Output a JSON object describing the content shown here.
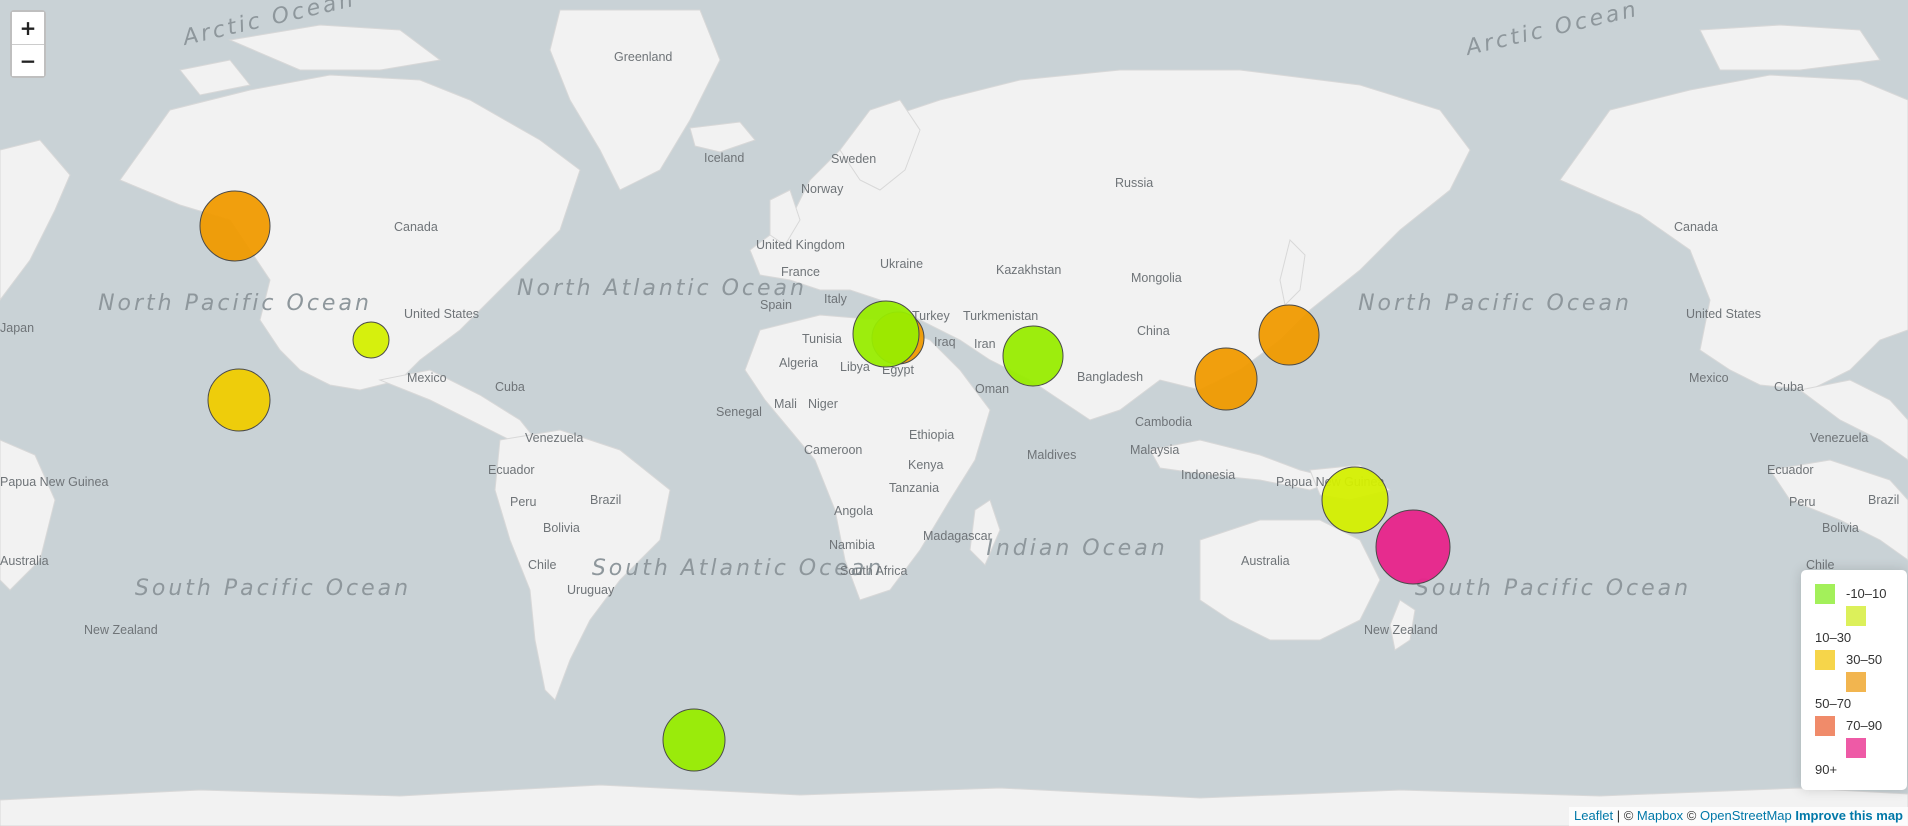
{
  "zoom": {
    "in_label": "+",
    "out_label": "−"
  },
  "oceans": [
    "Arctic Ocean",
    "Arctic Ocean",
    "North Pacific Ocean",
    "North Pacific Ocean",
    "North Atlantic Ocean",
    "South Pacific Ocean",
    "South Pacific Ocean",
    "South Atlantic Ocean",
    "Indian Ocean"
  ],
  "places": [
    "Greenland",
    "Iceland",
    "Sweden",
    "Norway",
    "Russia",
    "Canada",
    "Canada",
    "United Kingdom",
    "France",
    "Ukraine",
    "Kazakhstan",
    "Mongolia",
    "Spain",
    "Italy",
    "Turkey",
    "Turkmenistan",
    "United States",
    "United States",
    "Tunisia",
    "Iraq",
    "Iran",
    "China",
    "Algeria",
    "Libya",
    "Egypt",
    "Mexico",
    "Mexico",
    "Cuba",
    "Cuba",
    "Oman",
    "Bangladesh",
    "Senegal",
    "Mali",
    "Niger",
    "Venezuela",
    "Venezuela",
    "Ethiopia",
    "Cambodia",
    "Ecuador",
    "Ecuador",
    "Cameroon",
    "Maldives",
    "Malaysia",
    "Papua New Guinea",
    "Papua New Guinea",
    "Kenya",
    "Indonesia",
    "Peru",
    "Peru",
    "Brazil",
    "Brazil",
    "Tanzania",
    "Bolivia",
    "Bolivia",
    "Angola",
    "Madagascar",
    "Namibia",
    "Chile",
    "Chile",
    "South Africa",
    "Australia",
    "Australia",
    "Uruguay",
    "New Zealand",
    "New Zealand",
    "Japan"
  ],
  "earthquakes": [
    {
      "place": "Alaska",
      "depth_band": "50–70",
      "color": "#f09a00"
    },
    {
      "place": "Hawaii",
      "depth_band": "30–50",
      "color": "#f0cc00"
    },
    {
      "place": "California",
      "depth_band": "10–30",
      "color": "#d4ef00"
    },
    {
      "place": "Eastern Mediterranean",
      "depth_band": "50–70",
      "color": "#f09a00"
    },
    {
      "place": "Eastern Mediterranean",
      "depth_band": "-10–10",
      "color": "#98ec00"
    },
    {
      "place": "Pakistan",
      "depth_band": "-10–10",
      "color": "#98ec00"
    },
    {
      "place": "Philippines",
      "depth_band": "50–70",
      "color": "#f09a00"
    },
    {
      "place": "Japan",
      "depth_band": "50–70",
      "color": "#f09a00"
    },
    {
      "place": "Papua New Guinea",
      "depth_band": "10–30",
      "color": "#d4ef00"
    },
    {
      "place": "Vanuatu",
      "depth_band": "90+",
      "color": "#e8238a"
    },
    {
      "place": "South Atlantic",
      "depth_band": "-10–10",
      "color": "#98ec00"
    }
  ],
  "legend": {
    "items": [
      {
        "label": "-10–10",
        "color": "#a3f05a"
      },
      {
        "label": "10–30",
        "color": "#dcf05a"
      },
      {
        "label": "30–50",
        "color": "#f6d54a"
      },
      {
        "label": "50–70",
        "color": "#f2b54f"
      },
      {
        "label": "70–90",
        "color": "#f08b6a"
      },
      {
        "label": "90+",
        "color": "#ee5aa6"
      }
    ]
  },
  "attribution": {
    "leaflet": "Leaflet",
    "sep1": " | © ",
    "mapbox": "Mapbox",
    "sep2": " © ",
    "osm": "OpenStreetMap",
    "improve": "Improve this map"
  }
}
